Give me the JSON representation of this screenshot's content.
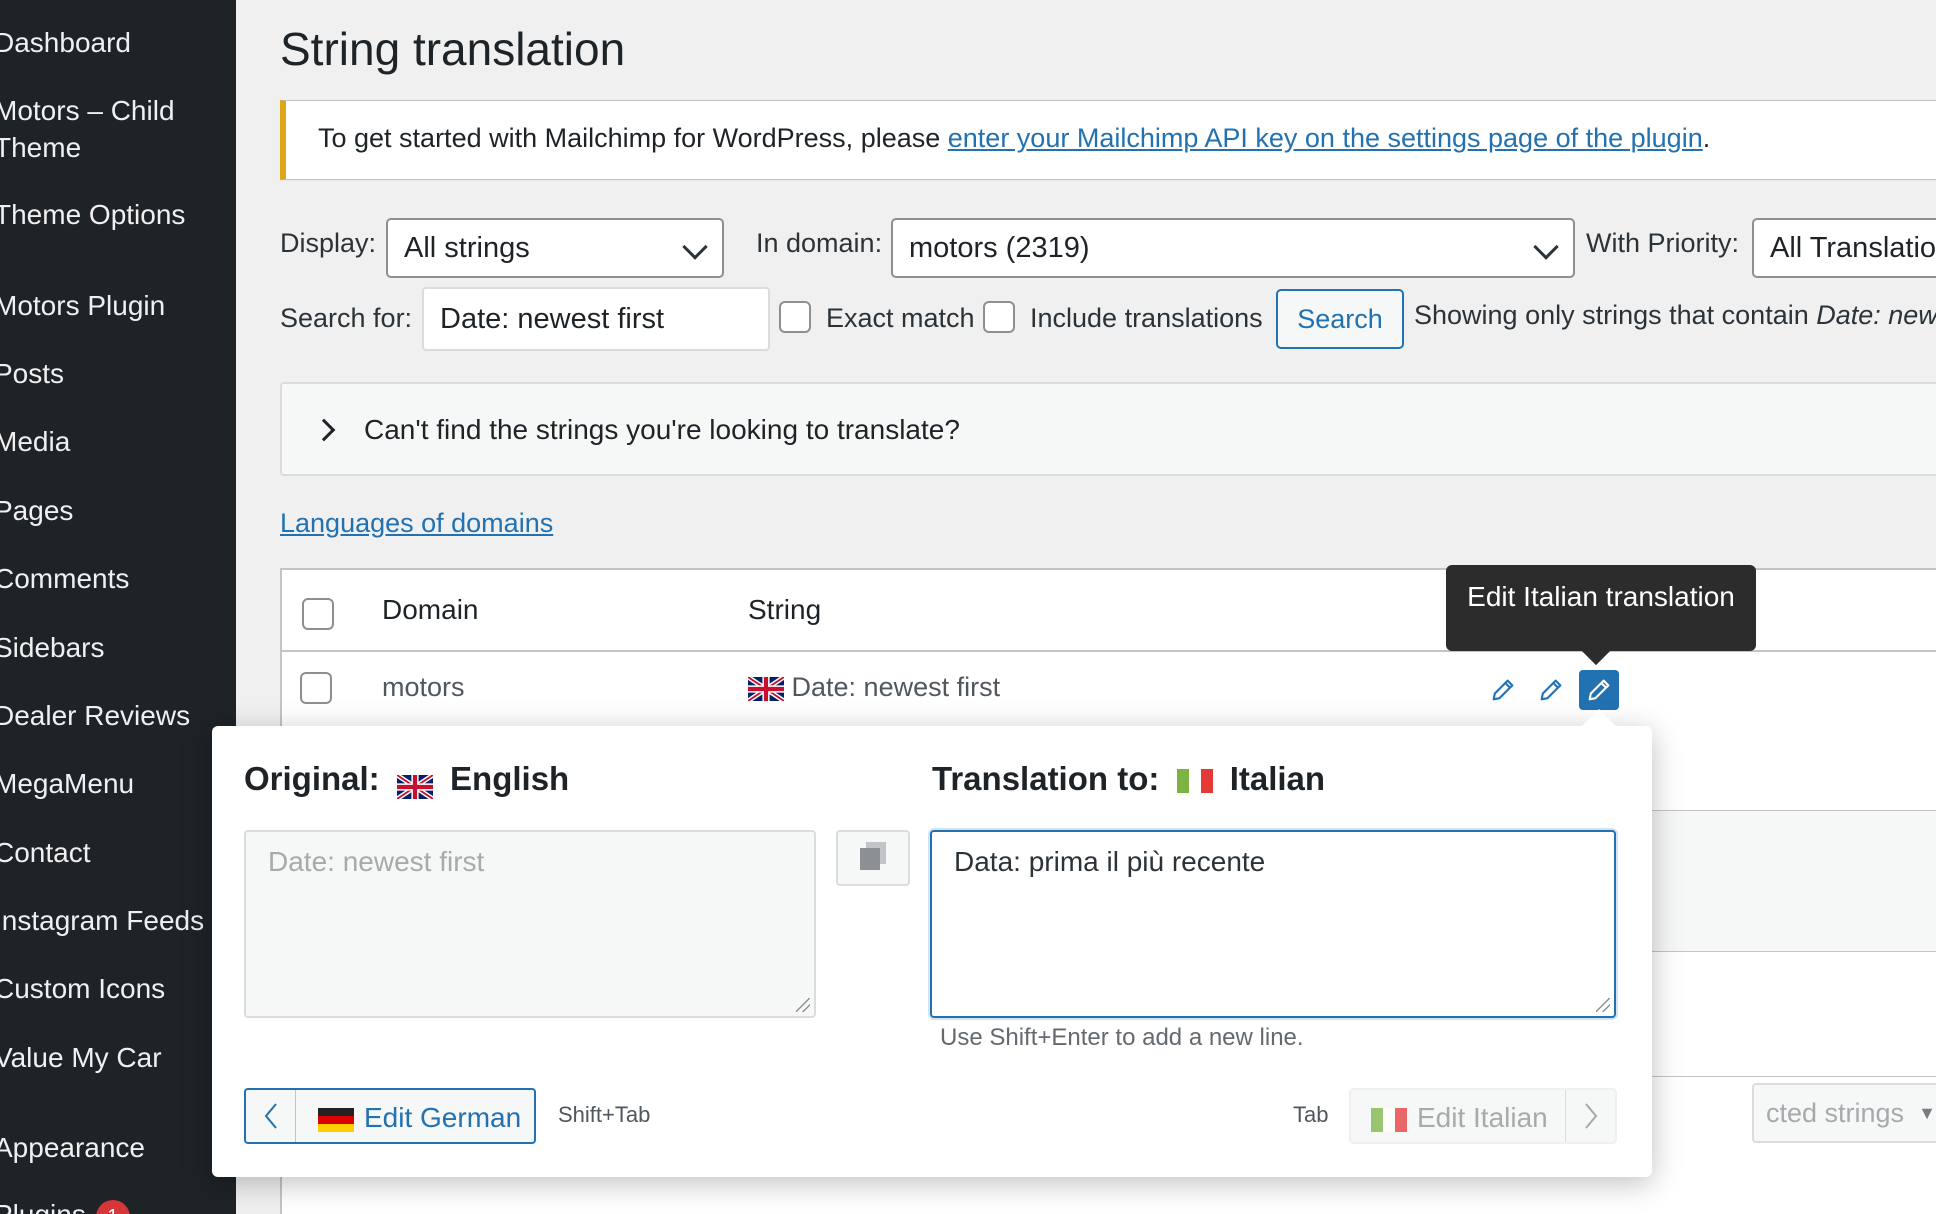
{
  "sidebar": {
    "items": [
      {
        "label": "Dashboard"
      },
      {
        "label": "Motors – Child"
      },
      {
        "label": "Theme"
      },
      {
        "label": "Theme Options"
      },
      {
        "label": "Motors Plugin"
      },
      {
        "label": "Posts"
      },
      {
        "label": "Media"
      },
      {
        "label": "Pages"
      },
      {
        "label": "Comments"
      },
      {
        "label": "Sidebars"
      },
      {
        "label": "Dealer Reviews"
      },
      {
        "label": "MegaMenu"
      },
      {
        "label": "Contact"
      },
      {
        "label": "Instagram Feeds"
      },
      {
        "label": "Custom Icons"
      },
      {
        "label": "Value My Car"
      },
      {
        "label": "Appearance"
      },
      {
        "label": "Plugins",
        "badge": "1"
      }
    ]
  },
  "page": {
    "title": "String translation"
  },
  "notice": {
    "text": "To get started with Mailchimp for WordPress, please ",
    "link": "enter your Mailchimp API key on the settings page of the plugin",
    "end": "."
  },
  "filters": {
    "display_label": "Display:",
    "display_value": "All strings",
    "domain_label": "In domain:",
    "domain_value": "motors (2319)",
    "priority_label": "With Priority:",
    "priority_value": "All Translatio",
    "search_label": "Search for:",
    "search_value": "Date: newest first",
    "exact_match": "Exact match",
    "include_translations": "Include translations",
    "search_button": "Search",
    "showing_text": "Showing only strings that contain ",
    "showing_term": "Date: new"
  },
  "collapse": {
    "text": "Can't find the strings you're looking to translate?"
  },
  "languages_link": "Languages of domains",
  "table": {
    "headers": {
      "domain": "Domain",
      "string": "String"
    },
    "rows": [
      {
        "domain": "motors",
        "string": "Date: newest first"
      }
    ],
    "bulk_select_placeholder": "cted strings"
  },
  "tooltip": "Edit Italian translation",
  "popup": {
    "original_label": "Original:",
    "original_lang": "English",
    "translation_label": "Translation to:",
    "translation_lang": "Italian",
    "original_text": "Date: newest first",
    "translation_text": "Data: prima il più recente",
    "hint": "Use Shift+Enter to add a new line.",
    "prev_button": "Edit German",
    "prev_shortcut": "Shift+Tab",
    "next_shortcut": "Tab",
    "next_button": "Edit Italian"
  },
  "colors": {
    "sidebar_bg": "#1d2327",
    "accent": "#2271b1",
    "notice_border": "#dba617",
    "badge": "#d63638"
  }
}
